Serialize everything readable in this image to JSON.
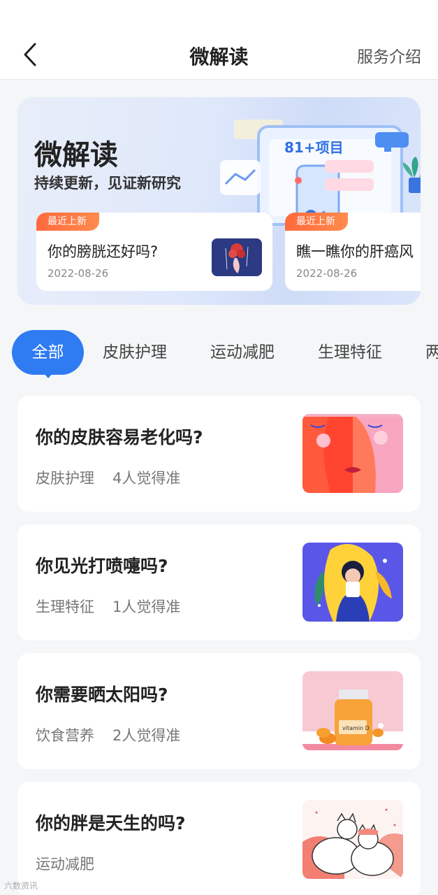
{
  "nav": {
    "title": "微解读",
    "right_label": "服务介绍",
    "back_icon": "chevron-left-icon"
  },
  "banner": {
    "title": "微解读",
    "subtitle": "持续更新，见证新研究",
    "badge": "81+项目",
    "recent": [
      {
        "tag": "最近上新",
        "title": "你的膀胱还好吗?",
        "date": "2022-08-26"
      },
      {
        "tag": "最近上新",
        "title": "瞧一瞧你的肝癌风",
        "date": "2022-08-26"
      }
    ]
  },
  "tabs": [
    "全部",
    "皮肤护理",
    "运动减肥",
    "生理特征",
    "两"
  ],
  "cards": [
    {
      "title": "你的皮肤容易老化吗?",
      "category": "皮肤护理",
      "votes": "4人觉得准"
    },
    {
      "title": "你见光打喷嚏吗?",
      "category": "生理特征",
      "votes": "1人觉得准"
    },
    {
      "title": "你需要晒太阳吗?",
      "category": "饮食营养",
      "votes": "2人觉得准",
      "thumb_label": "vitamin D"
    },
    {
      "title": "你的胖是天生的吗?",
      "category": "运动减肥",
      "votes": ""
    }
  ],
  "watermark": "六数资讯",
  "colors": {
    "accent": "#2f7bf2",
    "tag": "#ff6a3d"
  }
}
